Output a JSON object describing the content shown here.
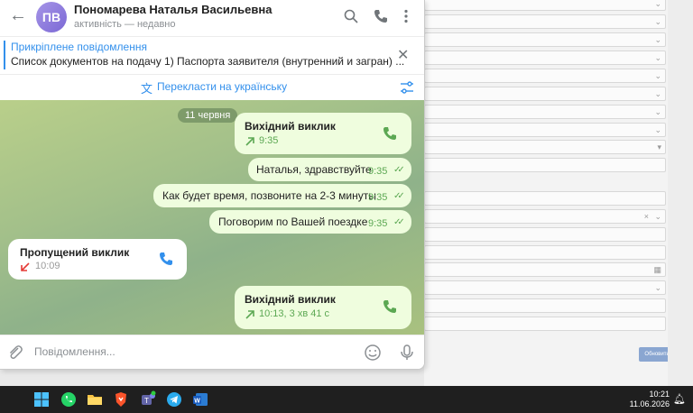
{
  "header": {
    "avatar_initials": "ПВ",
    "name": "Пономарева Наталья Васильевна",
    "status": "активність — недавно"
  },
  "pinned": {
    "title": "Прикріплене повідомлення",
    "text": "Список документов на подачу  1) Паспорта заявителя (внутренний и загран) ..."
  },
  "translate": {
    "label": "Перекласти на українську"
  },
  "chat": {
    "date_chip": "11 червня",
    "messages": [
      {
        "type": "call",
        "direction": "outgoing",
        "title": "Вихідний виклик",
        "meta": "9:35"
      },
      {
        "type": "text",
        "direction": "outgoing",
        "text": "Наталья, здравствуйте",
        "time": "9:35"
      },
      {
        "type": "text",
        "direction": "outgoing",
        "text": "Как будет время, позвоните на 2-3 минуты",
        "time": "9:35"
      },
      {
        "type": "text",
        "direction": "outgoing",
        "text": "Поговорим по Вашей поездке",
        "time": "9:35"
      },
      {
        "type": "call",
        "direction": "incoming",
        "title": "Пропущений виклик",
        "meta": "10:09"
      },
      {
        "type": "call",
        "direction": "outgoing",
        "title": "Вихідний виклик",
        "meta": "10:13, 3 хв 41 с"
      }
    ]
  },
  "composer": {
    "placeholder": "Повідомлення..."
  },
  "background_form": {
    "button_label": "Обновить"
  },
  "taskbar": {
    "time": "10:21",
    "date": "11.06.2026"
  },
  "colors": {
    "accent": "#3390ec",
    "outgoing_bubble": "#effdde",
    "check": "#5ca853",
    "missed": "#e53935"
  }
}
